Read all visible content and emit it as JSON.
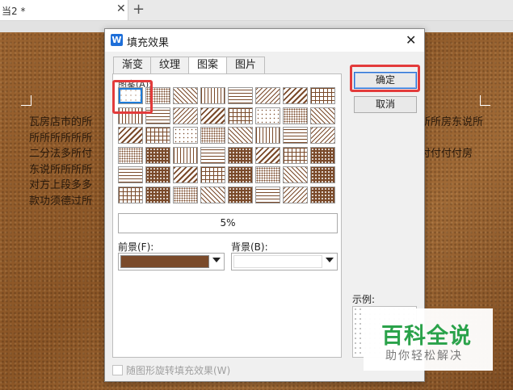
{
  "tabbar": {
    "doc_title": "当2 *",
    "close_glyph": "✕",
    "new_tab_glyph": "+"
  },
  "document": {
    "left_lines": [
      "瓦房店市的所",
      "所所所所所所",
      "二分法多所付",
      "东说所所所所",
      "对方上段多多",
      "款功须德过所"
    ],
    "right_lines": [
      "所所房东说所",
      "",
      "付付付付房",
      "",
      "",
      ""
    ]
  },
  "dialog": {
    "title": "填充效果",
    "app_icon_letter": "W",
    "close_glyph": "✕",
    "tabs": [
      {
        "label": "渐变",
        "active": false
      },
      {
        "label": "纹理",
        "active": false
      },
      {
        "label": "图案",
        "active": true
      },
      {
        "label": "图片",
        "active": false
      }
    ],
    "pattern_label": "图案(A):",
    "percent": "5%",
    "foreground_label": "前景(F):",
    "background_label": "背景(B):",
    "foreground_color": "#7a4a2a",
    "background_color": "#ffffff",
    "ok_label": "确定",
    "cancel_label": "取消",
    "sample_label": "示例:",
    "rotate_label": "随图形旋转填充效果(W)"
  },
  "watermark": {
    "main": "百科全说",
    "sub": "助你轻松解决"
  },
  "colors": {
    "accent": "#1e7cd8",
    "highlight": "#e33b3b",
    "leather": "#8a5526",
    "brand_green": "#2aa24a"
  }
}
